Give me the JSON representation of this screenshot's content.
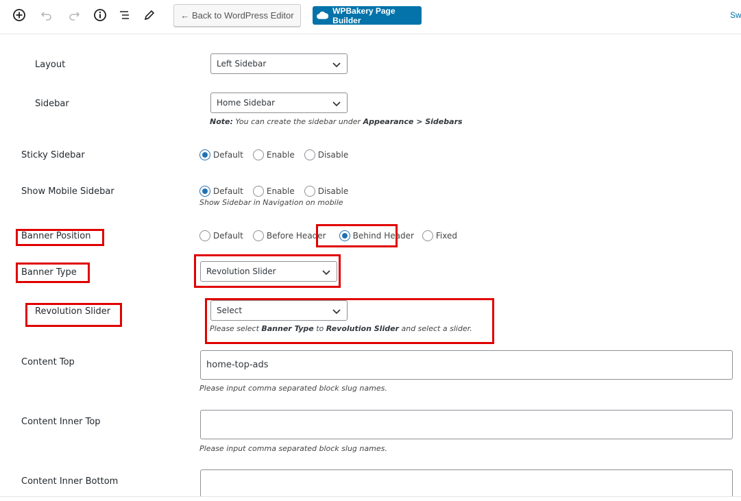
{
  "toolbar": {
    "back_label": "← Back to WordPress Editor",
    "builder_label": "WPBakery Page Builder",
    "switch_label": "Sw",
    "icons": [
      "add-block-icon",
      "undo-icon",
      "redo-icon",
      "info-icon",
      "outline-icon",
      "edit-icon"
    ]
  },
  "layout": {
    "label": "Layout",
    "value": "Left Sidebar"
  },
  "sidebar": {
    "label": "Sidebar",
    "value": "Home Sidebar",
    "note_prefix": "Note:",
    "note_mid": " You can create the sidebar under ",
    "note_path": "Appearance > Sidebars"
  },
  "sticky_sidebar": {
    "label": "Sticky Sidebar",
    "options": [
      "Default",
      "Enable",
      "Disable"
    ],
    "selected": "Default"
  },
  "mobile_sidebar": {
    "label": "Show Mobile Sidebar",
    "options": [
      "Default",
      "Enable",
      "Disable"
    ],
    "selected": "Default",
    "hint": "Show Sidebar in Navigation on mobile"
  },
  "banner_position": {
    "label": "Banner Position",
    "options": [
      "Default",
      "Before Header",
      "Behind Header",
      "Fixed"
    ],
    "selected": "Behind Header"
  },
  "banner_type": {
    "label": "Banner Type",
    "value": "Revolution Slider"
  },
  "revolution_slider": {
    "label": "Revolution Slider",
    "value": "Select",
    "hint_1": "Please select ",
    "hint_bold_1": "Banner Type",
    "hint_2": " to ",
    "hint_bold_2": "Revolution Slider",
    "hint_3": " and select a slider."
  },
  "content_top": {
    "label": "Content Top",
    "value": "home-top-ads",
    "hint": "Please input comma separated block slug names."
  },
  "content_inner_top": {
    "label": "Content Inner Top",
    "value": "",
    "hint": "Please input comma separated block slug names."
  },
  "content_inner_bottom": {
    "label": "Content Inner Bottom",
    "value": ""
  },
  "colors": {
    "highlight": "#e00000",
    "accent": "#0473aa",
    "radio_checked": "#2271b1"
  }
}
